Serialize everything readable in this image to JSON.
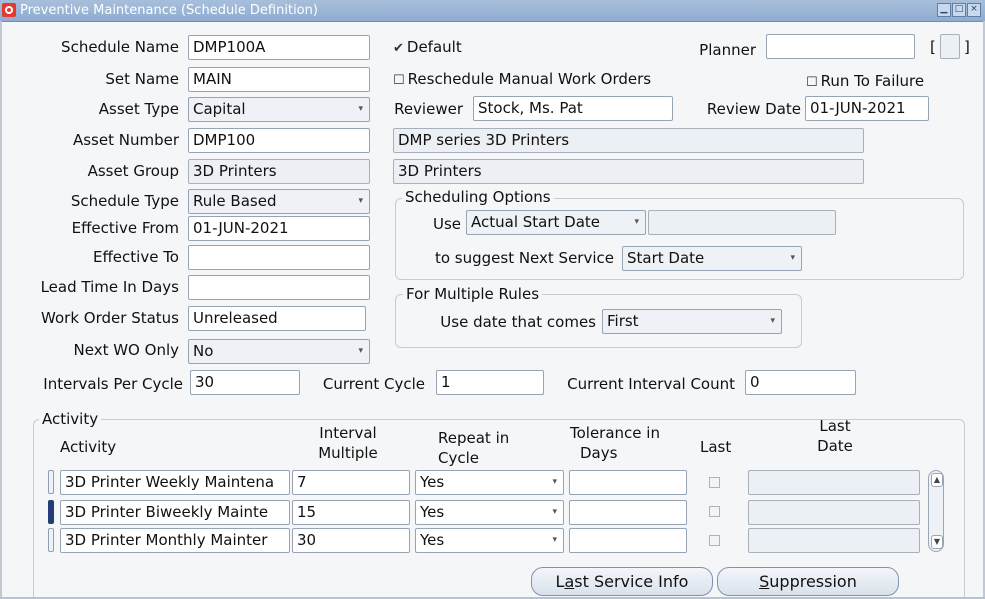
{
  "window": {
    "title": "Preventive Maintenance (Schedule Definition)"
  },
  "form": {
    "schedule_name": {
      "label": "Schedule Name",
      "value": "DMP100A"
    },
    "set_name": {
      "label": "Set Name",
      "value": "MAIN"
    },
    "asset_type": {
      "label": "Asset Type",
      "value": "Capital"
    },
    "asset_number": {
      "label": "Asset Number",
      "value": "DMP100",
      "description": "DMP series 3D Printers"
    },
    "asset_group": {
      "label": "Asset Group",
      "value": "3D Printers",
      "description": "3D Printers"
    },
    "schedule_type": {
      "label": "Schedule Type",
      "value": "Rule Based"
    },
    "effective_from": {
      "label": "Effective From",
      "value": "01-JUN-2021"
    },
    "effective_to": {
      "label": "Effective To",
      "value": ""
    },
    "lead_time": {
      "label": "Lead Time In Days",
      "value": ""
    },
    "work_order_status": {
      "label": "Work Order Status",
      "value": "Unreleased"
    },
    "next_wo_only": {
      "label": "Next WO Only",
      "value": "No"
    },
    "default_check": {
      "label": "Default",
      "mark": "✔"
    },
    "reschedule_manual": {
      "label": "Reschedule Manual Work Orders"
    },
    "run_to_failure": {
      "label": "Run To Failure"
    },
    "planner": {
      "label": "Planner",
      "value": ""
    },
    "planner_bracket_open": "[",
    "planner_bracket_close": "]",
    "reviewer": {
      "label": "Reviewer",
      "value": "Stock, Ms. Pat"
    },
    "review_date": {
      "label": "Review Date",
      "value": "01-JUN-2021"
    },
    "intervals_per_cycle": {
      "label": "Intervals Per Cycle",
      "value": "30"
    },
    "current_cycle": {
      "label": "Current Cycle",
      "value": "1"
    },
    "current_interval_count": {
      "label": "Current Interval Count",
      "value": "0"
    }
  },
  "scheduling_options": {
    "title": "Scheduling Options",
    "use_label": "Use",
    "use_value": "Actual Start Date",
    "suggest_label": "to suggest Next Service",
    "suggest_value": "Start Date"
  },
  "multiple_rules": {
    "title": "For Multiple Rules",
    "label": "Use date that comes",
    "value": "First"
  },
  "activity": {
    "group_title": "Activity",
    "headers": {
      "activity": "Activity",
      "interval_multiple_1": "Interval",
      "interval_multiple_2": "Multiple",
      "repeat_1": "Repeat in",
      "repeat_2": "Cycle",
      "tolerance_1": "Tolerance in",
      "tolerance_2": "Days",
      "last": "Last",
      "last_date_1": "Last",
      "last_date_2": "Date"
    },
    "rows": [
      {
        "activity": "3D Printer Weekly Maintena",
        "interval": "7",
        "repeat": "Yes",
        "tolerance": "",
        "last_date": ""
      },
      {
        "activity": "3D Printer Biweekly Mainte",
        "interval": "15",
        "repeat": "Yes",
        "tolerance": "",
        "last_date": ""
      },
      {
        "activity": "3D Printer Monthly Mainter",
        "interval": "30",
        "repeat": "Yes",
        "tolerance": "",
        "last_date": ""
      }
    ]
  },
  "buttons": {
    "last_service_pre": "L",
    "last_service_u": "a",
    "last_service_post": "st Service Info",
    "suppression_u": "S",
    "suppression_post": "uppression"
  },
  "icons": {
    "caret": "▾",
    "scroll_up": "▲",
    "scroll_down": "▼"
  }
}
